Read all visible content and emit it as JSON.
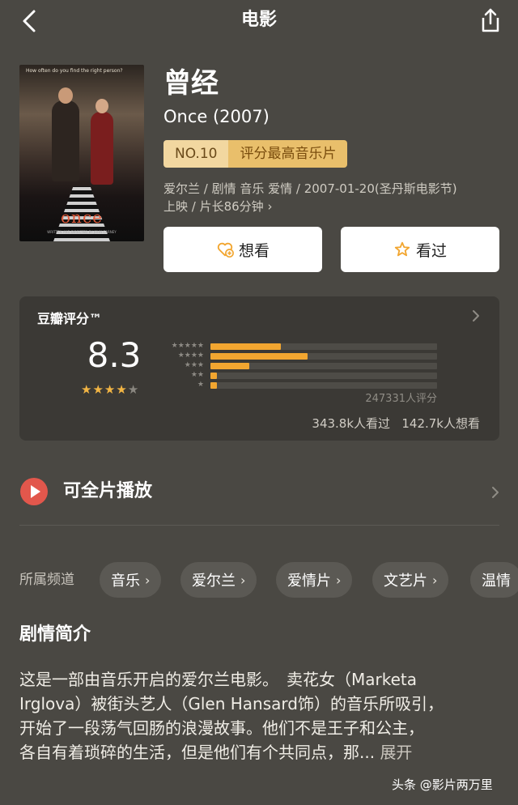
{
  "header": {
    "title": "电影"
  },
  "poster": {
    "tagline": "How often do you find the right person?",
    "title_art": "once",
    "credit": "WRITTEN AND DIRECTED BY JOHN CARNEY"
  },
  "movie": {
    "title": "曾经",
    "subtitle": "Once (2007)",
    "rank_no": "NO.10",
    "rank_label": "评分最高音乐片",
    "meta_line1": "爱尔兰 / 剧情 音乐 爱情 / 2007-01-20(圣丹斯电影节)",
    "meta_line2": "上映 / 片长86分钟",
    "meta_chevron": "›"
  },
  "actions": {
    "want": "想看",
    "seen": "看过"
  },
  "rating": {
    "title": "豆瓣评分™",
    "score": "8.3",
    "stars_filled": 4,
    "stars_total": 5,
    "distribution": [
      {
        "stars": "★★★★★",
        "fraction": 0.31
      },
      {
        "stars": "★★★★",
        "fraction": 0.43
      },
      {
        "stars": "★★★",
        "fraction": 0.17
      },
      {
        "stars": "★★",
        "fraction": 0.03
      },
      {
        "stars": "★",
        "fraction": 0.03
      }
    ],
    "raters": "247331人评分",
    "watched": "343.8k人看过",
    "wants": "142.7k人想看"
  },
  "play": {
    "label": "可全片播放"
  },
  "channels": {
    "label": "所属频道",
    "items": [
      {
        "label": "音乐",
        "chevron": "›"
      },
      {
        "label": "爱尔兰",
        "chevron": "›"
      },
      {
        "label": "爱情片",
        "chevron": "›"
      },
      {
        "label": "文艺片",
        "chevron": "›"
      },
      {
        "label": "温情",
        "chevron": ""
      }
    ]
  },
  "synopsis": {
    "title": "剧情简介",
    "line1": "这是一部由音乐开启的爱尔兰电影。　卖花女（Marketa",
    "line2": "Irglova）被街头艺人（Glen Hansard饰）的音乐所吸引，",
    "line3": "开始了一段荡气回肠的浪漫故事。他们不是王子和公主，",
    "line4": "各自有着琐碎的生活，但是他们有个共同点，那...",
    "expand": "展开"
  },
  "watermark": "头条 @影片两万里",
  "colors": {
    "accent": "#f2a630",
    "background": "#4a4843",
    "card": "#3b3935",
    "rank_bg": "#e9bf6b"
  }
}
